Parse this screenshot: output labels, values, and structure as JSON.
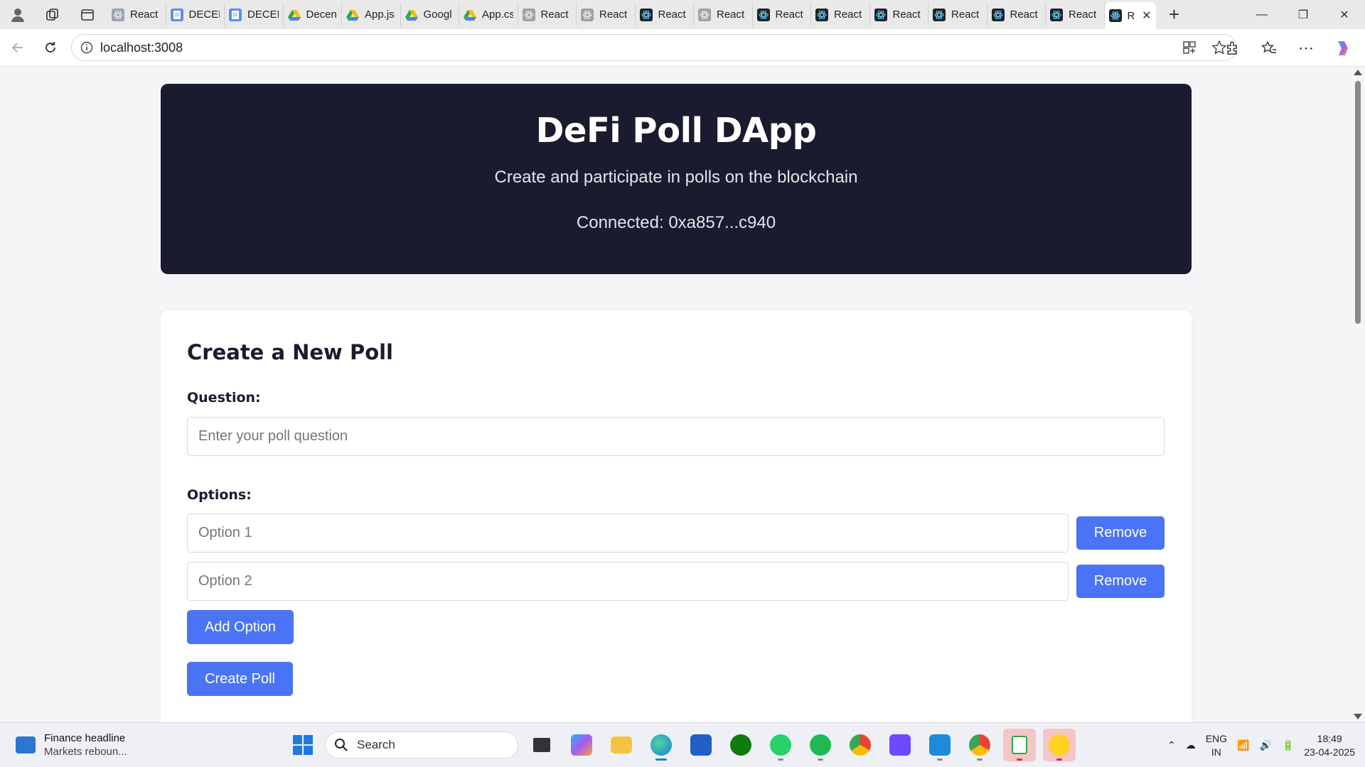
{
  "browser": {
    "tabs": [
      {
        "label": "React",
        "favicon": "react-grey"
      },
      {
        "label": "DECEN",
        "favicon": "doc"
      },
      {
        "label": "DECEN",
        "favicon": "doc"
      },
      {
        "label": "Decen",
        "favicon": "drive"
      },
      {
        "label": "App.js",
        "favicon": "drive"
      },
      {
        "label": "Googl",
        "favicon": "drive"
      },
      {
        "label": "App.cs",
        "favicon": "drive"
      },
      {
        "label": "React",
        "favicon": "react-grey"
      },
      {
        "label": "React",
        "favicon": "react-grey"
      },
      {
        "label": "React",
        "favicon": "react"
      },
      {
        "label": "React",
        "favicon": "react-grey"
      },
      {
        "label": "React",
        "favicon": "react"
      },
      {
        "label": "React",
        "favicon": "react"
      },
      {
        "label": "React",
        "favicon": "react"
      },
      {
        "label": "React",
        "favicon": "react"
      },
      {
        "label": "React",
        "favicon": "react"
      },
      {
        "label": "React",
        "favicon": "react"
      }
    ],
    "active_tab": {
      "label": "R",
      "favicon": "react"
    },
    "url": "localhost:3008"
  },
  "hero": {
    "title": "DeFi Poll DApp",
    "subtitle": "Create and participate in polls on the blockchain",
    "connected": "Connected: 0xa857...c940"
  },
  "form": {
    "heading": "Create a New Poll",
    "question_label": "Question:",
    "question_placeholder": "Enter your poll question",
    "options_label": "Options:",
    "options": [
      {
        "placeholder": "Option 1",
        "remove_label": "Remove"
      },
      {
        "placeholder": "Option 2",
        "remove_label": "Remove"
      }
    ],
    "add_option_label": "Add Option",
    "create_poll_label": "Create Poll"
  },
  "taskbar": {
    "news_title": "Finance headline",
    "news_sub": "Markets reboun...",
    "search_label": "Search",
    "lang_line1": "ENG",
    "lang_line2": "IN",
    "time": "18:49",
    "date": "23-04-2025"
  },
  "colors": {
    "hero_bg": "#1b1b2f",
    "primary_button": "#4a74f5",
    "page_bg": "#f5f5f7"
  }
}
